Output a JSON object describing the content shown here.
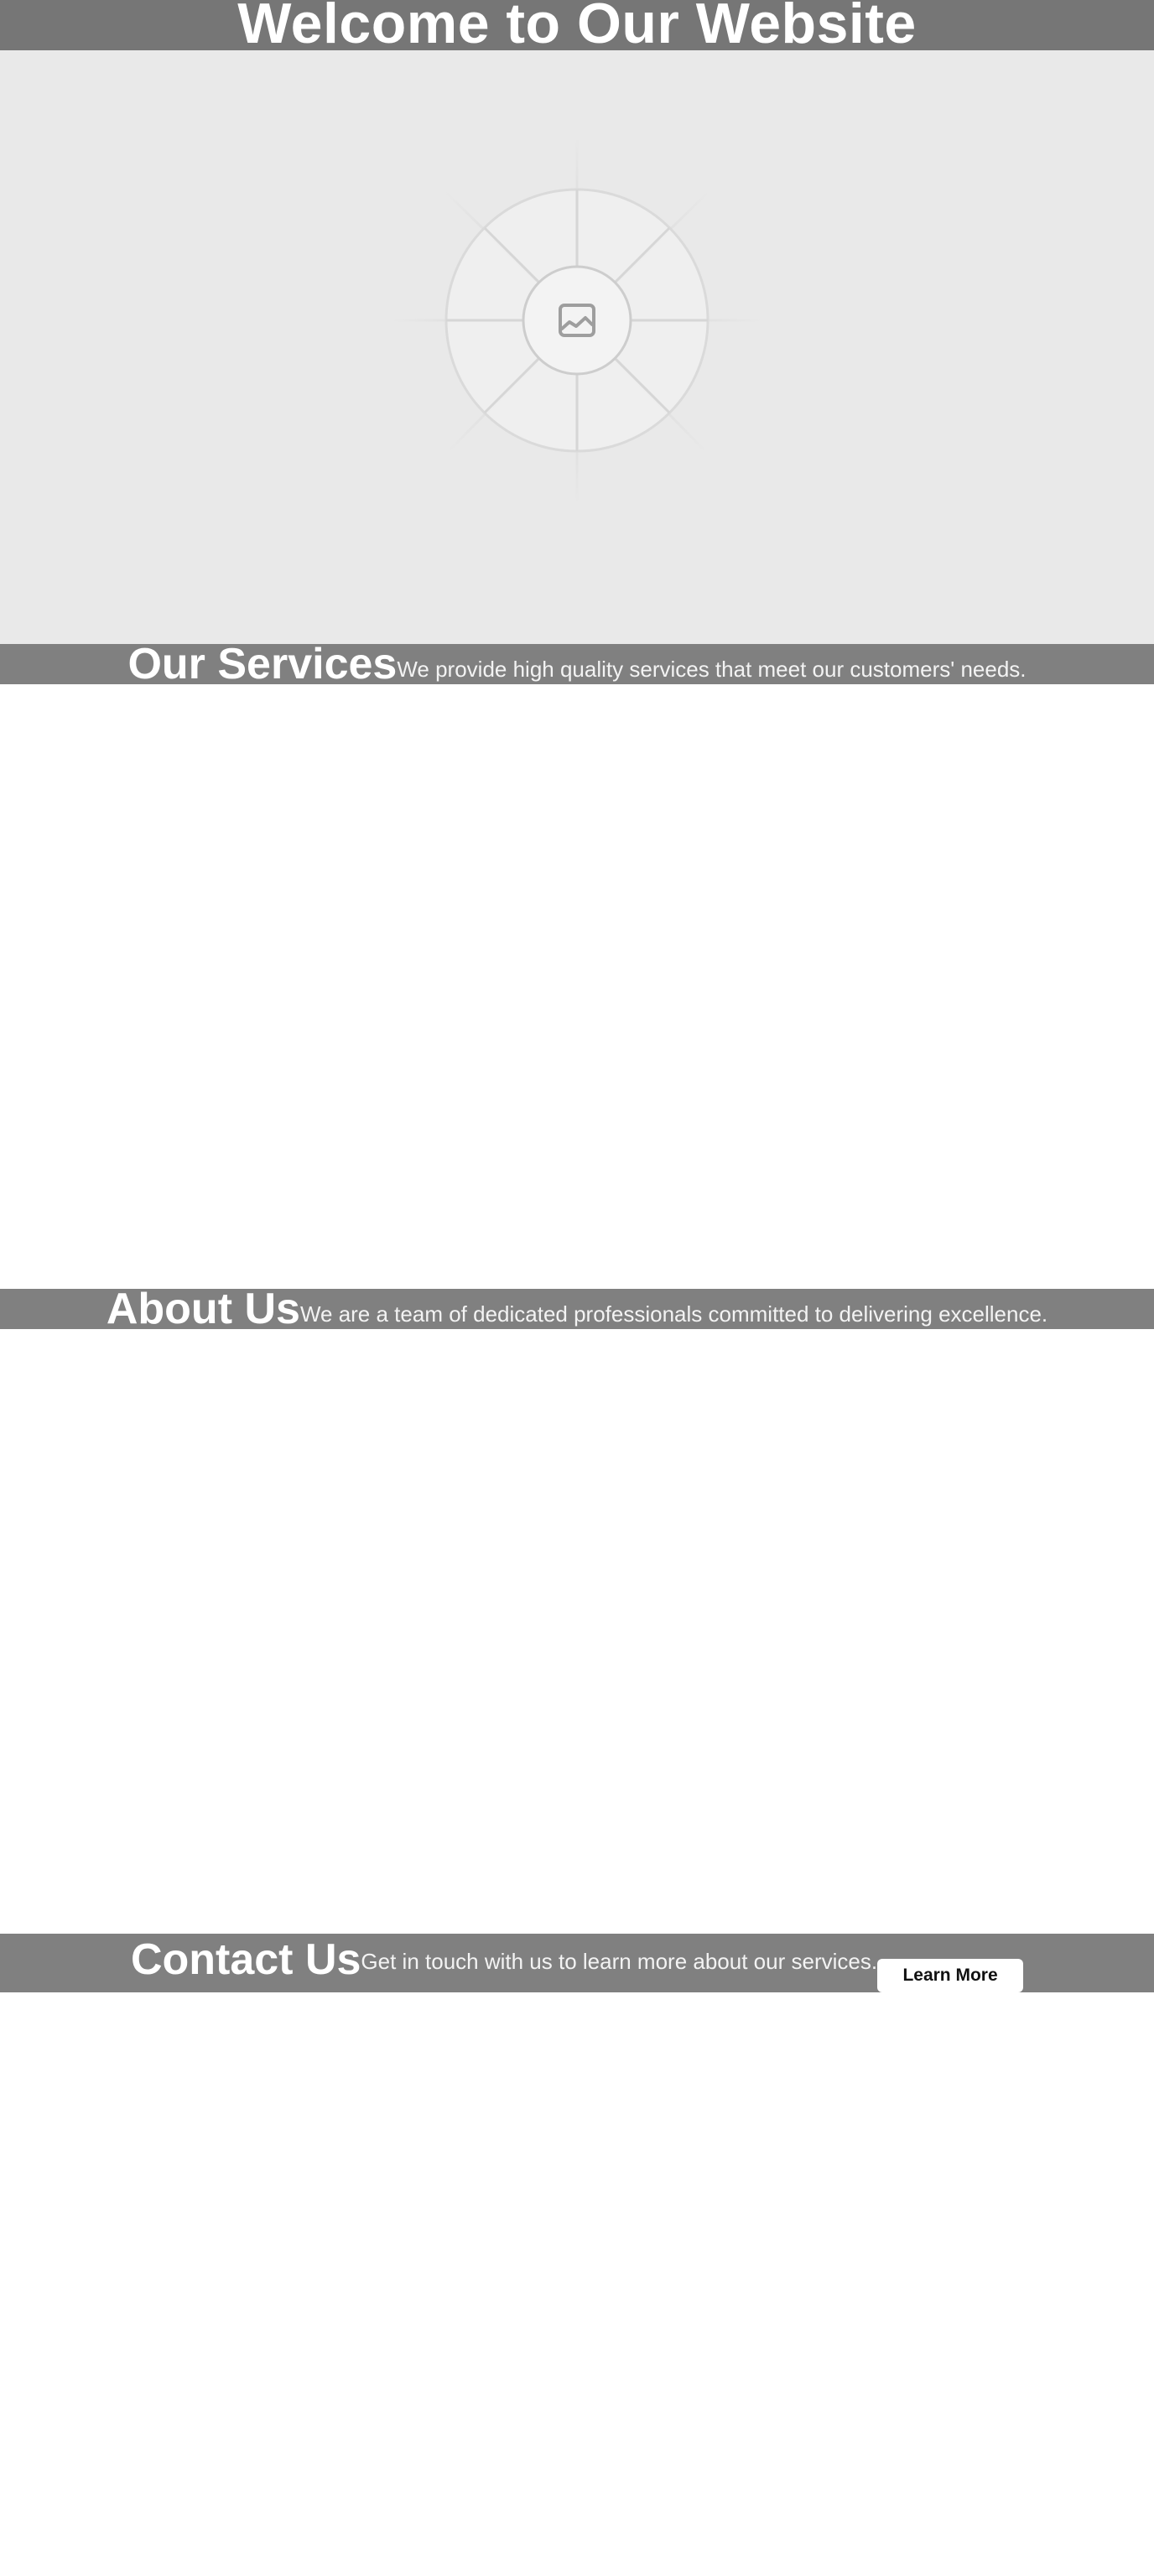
{
  "header": {
    "title": "Welcome to Our Website"
  },
  "hero": {
    "image_icon": "image-placeholder-icon"
  },
  "services": {
    "title": "Our Services",
    "text": "We provide high quality services that meet our customers' needs."
  },
  "about": {
    "title": "About Us",
    "text": "We are a team of dedicated professionals committed to delivering excellence."
  },
  "contact": {
    "title": "Contact Us",
    "text": "Get in touch with us to learn more about our services.",
    "button_label": "Learn More"
  },
  "colors": {
    "band": "#808080",
    "header_band": "#767676",
    "hero_bg": "#e9e9e9",
    "text": "#ffffff",
    "button_bg": "#ffffff"
  }
}
